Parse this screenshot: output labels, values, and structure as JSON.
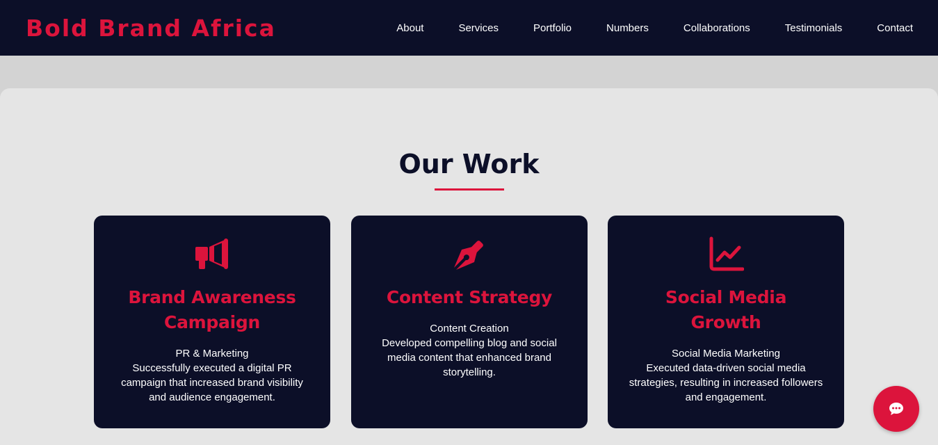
{
  "header": {
    "brand": "Bold Brand Africa",
    "nav": [
      "About",
      "Services",
      "Portfolio",
      "Numbers",
      "Collaborations",
      "Testimonials",
      "Contact"
    ]
  },
  "work": {
    "title": "Our Work",
    "cards": [
      {
        "icon": "megaphone-icon",
        "title": "Brand Awareness Campaign",
        "category": "PR & Marketing",
        "description": "Successfully executed a digital PR campaign that increased brand visibility and audience engagement."
      },
      {
        "icon": "pen-nib-icon",
        "title": "Content Strategy",
        "category": "Content Creation",
        "description": "Developed compelling blog and social media content that enhanced brand storytelling."
      },
      {
        "icon": "chart-line-icon",
        "title": "Social Media Growth",
        "category": "Social Media Marketing",
        "description": "Executed data-driven social media strategies, resulting in increased followers and engagement."
      }
    ]
  },
  "colors": {
    "navy": "#0c0f28",
    "accent": "#dc143c",
    "section_bg": "#e5e5e5",
    "page_bg": "#d3d3d3"
  },
  "chat": {
    "icon": "chat-bubble-icon"
  }
}
